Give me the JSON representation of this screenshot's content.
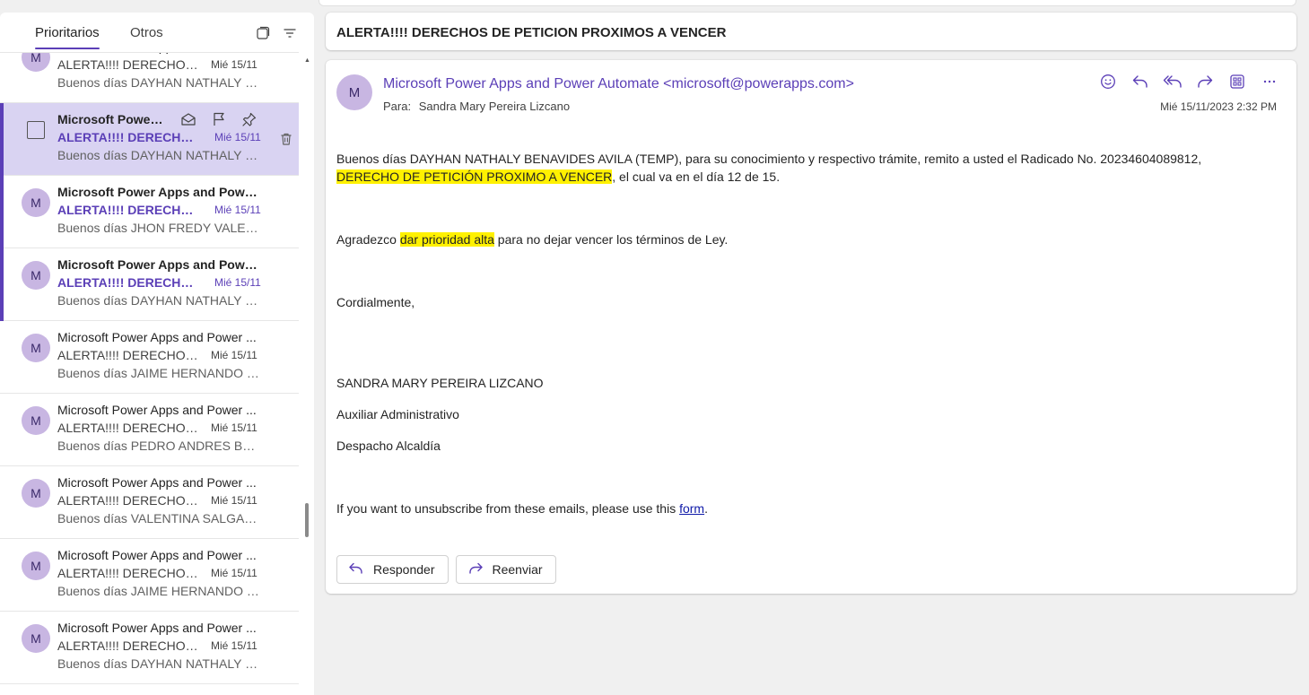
{
  "list": {
    "tabs": [
      {
        "label": "Prioritarios",
        "active": true
      },
      {
        "label": "Otros",
        "active": false
      }
    ],
    "messages": [
      {
        "avatar": "M",
        "sender": "Microsoft Power Apps and Power ...",
        "subject": "ALERTA!!!! DERECHOS ...",
        "date": "Mié 15/11",
        "preview": "Buenos días DAYHAN NATHALY BE...",
        "state": "read"
      },
      {
        "avatar": "",
        "sender": "Microsoft Power ...",
        "subject": "ALERTA!!!! DERECHOS ...",
        "date": "Mié 15/11",
        "preview": "Buenos días DAYHAN NATHALY BE...",
        "state": "selected"
      },
      {
        "avatar": "M",
        "sender": "Microsoft Power Apps and Power...",
        "subject": "ALERTA!!!! DERECHOS ...",
        "date": "Mié 15/11",
        "preview": "Buenos días JHON FREDY VALERO ...",
        "state": "unread"
      },
      {
        "avatar": "M",
        "sender": "Microsoft Power Apps and Power...",
        "subject": "ALERTA!!!! DERECHOS ...",
        "date": "Mié 15/11",
        "preview": "Buenos días DAYHAN NATHALY BE...",
        "state": "unread"
      },
      {
        "avatar": "M",
        "sender": "Microsoft Power Apps and Power ...",
        "subject": "ALERTA!!!! DERECHOS ...",
        "date": "Mié 15/11",
        "preview": "Buenos días JAIME HERNANDO PR...",
        "state": "read"
      },
      {
        "avatar": "M",
        "sender": "Microsoft Power Apps and Power ...",
        "subject": "ALERTA!!!! DERECHOS ...",
        "date": "Mié 15/11",
        "preview": "Buenos días PEDRO ANDRES BAR...",
        "state": "read"
      },
      {
        "avatar": "M",
        "sender": "Microsoft Power Apps and Power ...",
        "subject": "ALERTA!!!! DERECHOS ...",
        "date": "Mié 15/11",
        "preview": "Buenos días VALENTINA SALGAD...",
        "state": "read"
      },
      {
        "avatar": "M",
        "sender": "Microsoft Power Apps and Power ...",
        "subject": "ALERTA!!!! DERECHOS ...",
        "date": "Mié 15/11",
        "preview": "Buenos días JAIME HERNANDO PR...",
        "state": "read"
      },
      {
        "avatar": "M",
        "sender": "Microsoft Power Apps and Power ...",
        "subject": "ALERTA!!!! DERECHOS ...",
        "date": "Mié 15/11",
        "preview": "Buenos días DAYHAN NATHALY BE...",
        "state": "read"
      }
    ]
  },
  "reading": {
    "subject": "ALERTA!!!!  DERECHOS DE PETICION PROXIMOS A VENCER",
    "avatar": "M",
    "from": "Microsoft Power Apps and Power Automate <microsoft@powerapps.com>",
    "to_label": "Para:",
    "to": "Sandra Mary Pereira Lizcano",
    "date": "Mié 15/11/2023 2:32 PM",
    "body": {
      "p1_a": "Buenos días DAYHAN NATHALY BENAVIDES AVILA (TEMP), para su conocimiento y respectivo trámite, remito a usted el Radicado No. 20234604089812,",
      "p1_highlight": "DERECHO DE PETICIÓN PROXIMO A VENCER",
      "p1_b": ", el cual va en el día 12 de 15.",
      "p2_a": "Agradezco ",
      "p2_highlight": "dar prioridad alta",
      "p2_b": " para no dejar vencer los términos de Ley.",
      "closing": "Cordialmente,",
      "sig_name": "SANDRA MARY PEREIRA LIZCANO",
      "sig_role": "Auxiliar Administrativo",
      "sig_office": "Despacho Alcaldía",
      "unsub_a": "If you want to unsubscribe from these emails, please use this ",
      "unsub_link": "form",
      "unsub_b": "."
    },
    "reply_label": "Responder",
    "forward_label": "Reenviar"
  },
  "colors": {
    "accent": "#5b3fb7",
    "selected_bg": "#d9d3f2",
    "avatar_bg": "#c8b6e2",
    "highlight": "#fff100",
    "link": "#0f1aa8"
  },
  "icons": [
    "select-mode-icon",
    "filter-icon",
    "mark-read-icon",
    "flag-icon",
    "pin-icon",
    "trash-icon",
    "emoji-icon",
    "reply-icon",
    "reply-all-icon",
    "forward-icon",
    "apps-icon",
    "more-icon"
  ]
}
